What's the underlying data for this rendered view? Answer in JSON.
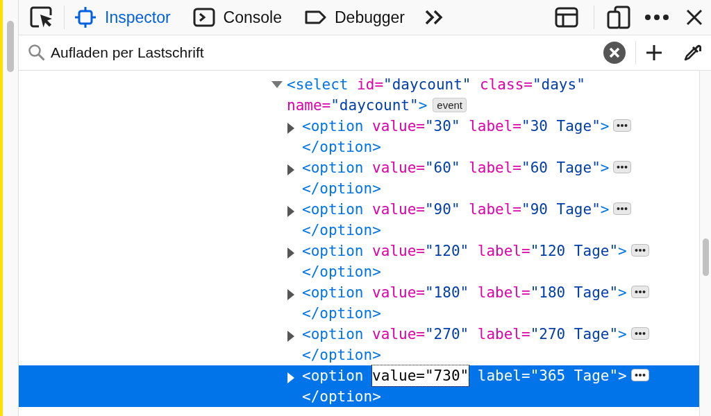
{
  "toolbar": {
    "tabs": [
      {
        "kind": "inspector",
        "label": "Inspector",
        "selected": true
      },
      {
        "kind": "console",
        "label": "Console",
        "selected": false
      },
      {
        "kind": "debugger",
        "label": "Debugger",
        "selected": false
      }
    ]
  },
  "search": {
    "value": "Aufladen per Lastschrift"
  },
  "tree": [
    {
      "kind": "element",
      "open": "<select",
      "attrs": [
        {
          "name": "id=",
          "value": "\"daycount\"",
          "focused": false
        },
        {
          "name": "class=",
          "value": "\"days\"",
          "focused": false
        },
        {
          "name": "name=",
          "value": "\"daycount\"",
          "focused": false
        }
      ],
      "close": ">",
      "badge": "event",
      "expanded": true,
      "selected": false,
      "children": [
        {
          "kind": "element",
          "open": "<option",
          "attrs": [
            {
              "name": "value=",
              "value": "\"30\"",
              "focused": false
            },
            {
              "name": "label=",
              "value": "\"30 Tage\"",
              "focused": false
            }
          ],
          "close": ">",
          "end": "</option>",
          "expanded": false,
          "selected": false
        },
        {
          "kind": "element",
          "open": "<option",
          "attrs": [
            {
              "name": "value=",
              "value": "\"60\"",
              "focused": false
            },
            {
              "name": "label=",
              "value": "\"60 Tage\"",
              "focused": false
            }
          ],
          "close": ">",
          "end": "</option>",
          "expanded": false,
          "selected": false
        },
        {
          "kind": "element",
          "open": "<option",
          "attrs": [
            {
              "name": "value=",
              "value": "\"90\"",
              "focused": false
            },
            {
              "name": "label=",
              "value": "\"90 Tage\"",
              "focused": false
            }
          ],
          "close": ">",
          "end": "</option>",
          "expanded": false,
          "selected": false
        },
        {
          "kind": "element",
          "open": "<option",
          "attrs": [
            {
              "name": "value=",
              "value": "\"120\"",
              "focused": false
            },
            {
              "name": "label=",
              "value": "\"120 Tage\"",
              "focused": false
            }
          ],
          "close": ">",
          "end": "</option>",
          "expanded": false,
          "selected": false
        },
        {
          "kind": "element",
          "open": "<option",
          "attrs": [
            {
              "name": "value=",
              "value": "\"180\"",
              "focused": false
            },
            {
              "name": "label=",
              "value": "\"180 Tage\"",
              "focused": false
            }
          ],
          "close": ">",
          "end": "</option>",
          "expanded": false,
          "selected": false
        },
        {
          "kind": "element",
          "open": "<option",
          "attrs": [
            {
              "name": "value=",
              "value": "\"270\"",
              "focused": false
            },
            {
              "name": "label=",
              "value": "\"270 Tage\"",
              "focused": false
            }
          ],
          "close": ">",
          "end": "</option>",
          "expanded": false,
          "selected": false
        },
        {
          "kind": "element",
          "open": "<option",
          "attrs": [
            {
              "name": "value=",
              "value": "\"730\"",
              "focused": true
            },
            {
              "name": "label=",
              "value": "\"365 Tage\"",
              "focused": false
            }
          ],
          "close": ">",
          "end": "</option>",
          "expanded": false,
          "selected": true
        }
      ]
    }
  ]
}
